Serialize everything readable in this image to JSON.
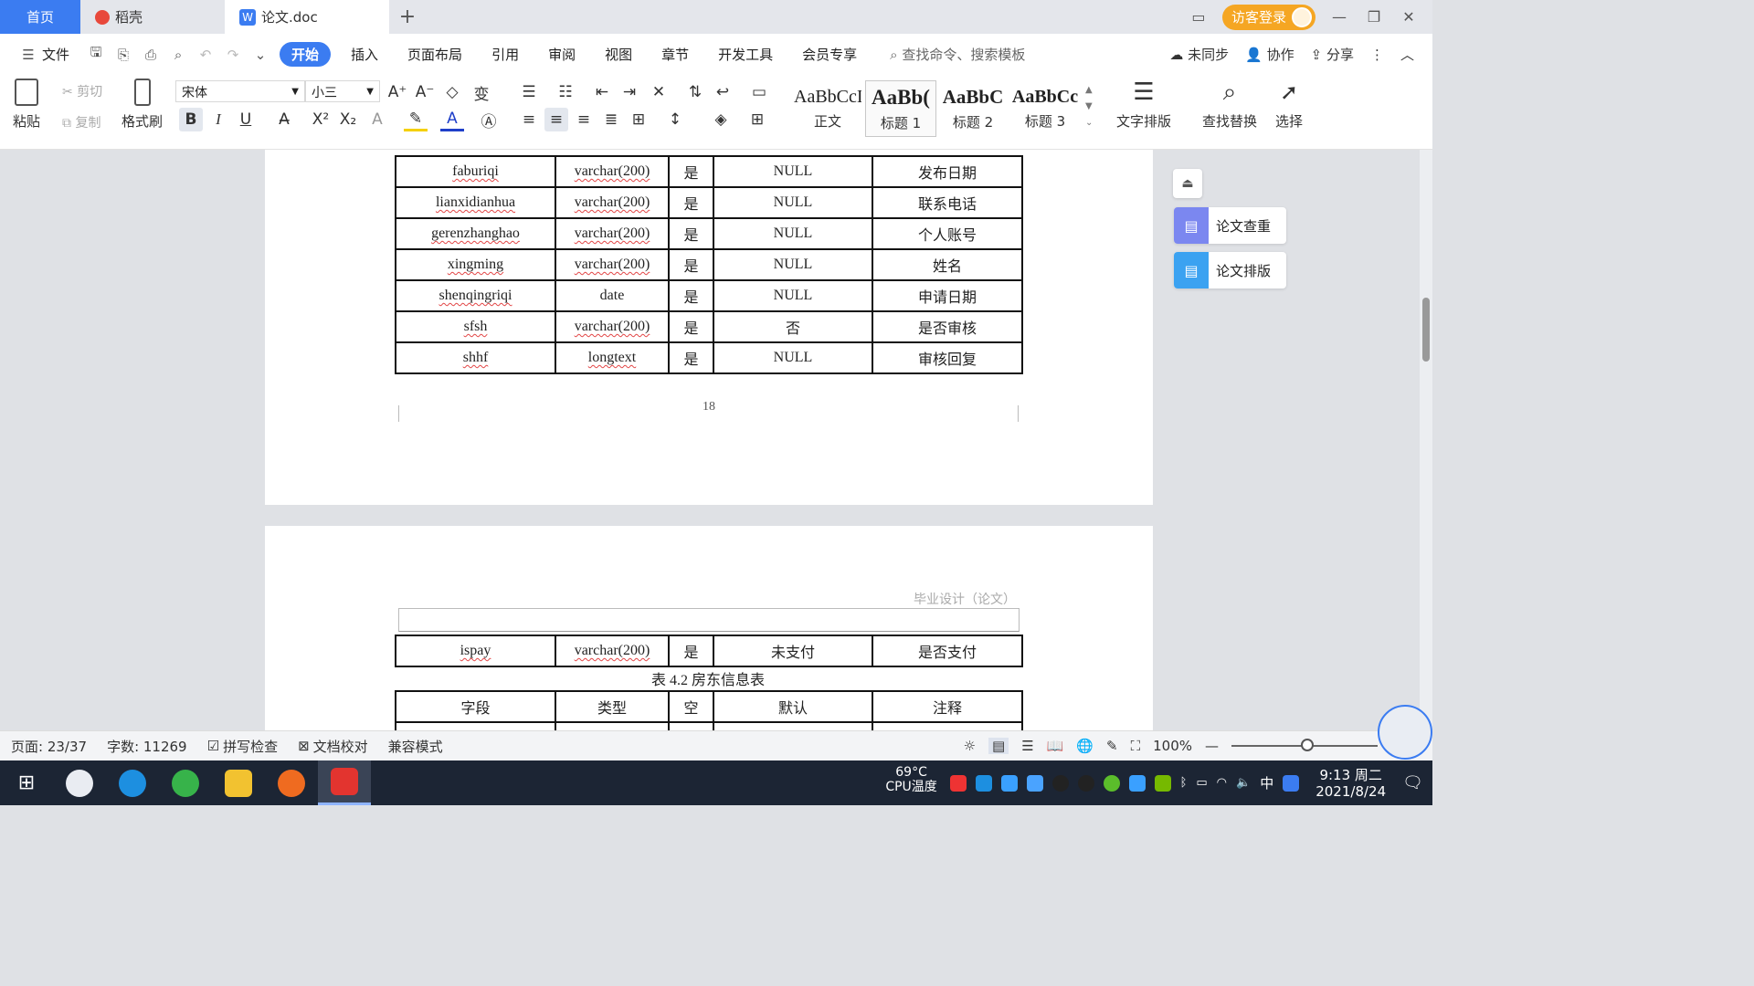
{
  "tabs": {
    "home": "首页",
    "wps": "稻壳",
    "doc": "论文.doc",
    "add": "+"
  },
  "titlebar": {
    "login": "访客登录"
  },
  "menu": {
    "file": "文件",
    "items": [
      "开始",
      "插入",
      "页面布局",
      "引用",
      "审阅",
      "视图",
      "章节",
      "开发工具",
      "会员专享"
    ],
    "search": "查找命令、搜索模板",
    "sync": "未同步",
    "collab": "协作",
    "share": "分享"
  },
  "ribbon": {
    "paste": "粘贴",
    "cut": "剪切",
    "copy": "复制",
    "format_painter": "格式刷",
    "font_name": "宋体",
    "font_size": "小三",
    "styles": [
      {
        "sample": "AaBbCcI",
        "label": "正文"
      },
      {
        "sample": "AaBb(",
        "label": "标题 1"
      },
      {
        "sample": "AaBbC",
        "label": "标题 2"
      },
      {
        "sample": "AaBbCc",
        "label": "标题 3"
      }
    ],
    "text_layout": "文字排版",
    "find_replace": "查找替换",
    "select": "选择"
  },
  "table1_rows": [
    [
      "faburiqi",
      "varchar(200)",
      "是",
      "NULL",
      "发布日期"
    ],
    [
      "lianxidianhua",
      "varchar(200)",
      "是",
      "NULL",
      "联系电话"
    ],
    [
      "gerenzhanghao",
      "varchar(200)",
      "是",
      "NULL",
      "个人账号"
    ],
    [
      "xingming",
      "varchar(200)",
      "是",
      "NULL",
      "姓名"
    ],
    [
      "shenqingriqi",
      "date",
      "是",
      "NULL",
      "申请日期"
    ],
    [
      "sfsh",
      "varchar(200)",
      "是",
      "否",
      "是否审核"
    ],
    [
      "shhf",
      "longtext",
      "是",
      "NULL",
      "审核回复"
    ]
  ],
  "page_number": "18",
  "page2": {
    "header": "毕业设计（论文）",
    "row": [
      "ispay",
      "varchar(200)",
      "是",
      "未支付",
      "是否支付"
    ],
    "caption": "表 4.2  房东信息表",
    "table_header": [
      "字段",
      "类型",
      "空",
      "默认",
      "注释"
    ]
  },
  "side_panel": {
    "check": "论文查重",
    "layout": "论文排版"
  },
  "status": {
    "page": "页面: 23/37",
    "words": "字数: 11269",
    "spell": "拼写检查",
    "proof": "文档校对",
    "compat": "兼容模式",
    "zoom": "100%"
  },
  "taskbar": {
    "cpu_temp": "69°C",
    "cpu_label": "CPU温度",
    "ime": "中",
    "time": "9:13 周二",
    "date": "2021/8/24"
  },
  "colors": {
    "accent": "#3b7cf1",
    "login": "#f5a623",
    "taskbar": "#1c2534"
  }
}
